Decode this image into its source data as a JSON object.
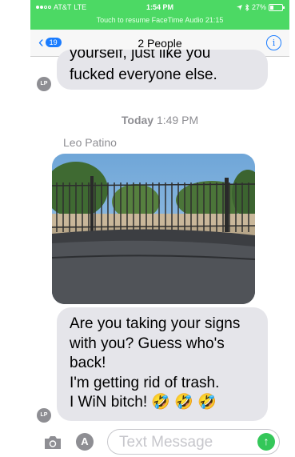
{
  "status_bar": {
    "carrier": "AT&T",
    "network": "LTE",
    "time": "1:54 PM",
    "battery": "27%",
    "battery_level": 0.27,
    "resume_text": "Touch to resume FaceTime Audio 21:15"
  },
  "nav": {
    "back_count": "19",
    "title": "2 People",
    "info_glyph": "i"
  },
  "messages": {
    "previous_text_top": "yourself, just like you",
    "previous_text": "fucked everyone else.",
    "previous_avatar": "LP",
    "timestamp_day": "Today",
    "timestamp_time": "1:49 PM",
    "sender": "Leo Patino",
    "last_lines": [
      "Are you taking your signs",
      "with you? Guess who's",
      "back!",
      "I'm getting rid of trash.",
      "I WiN bitch! 🤣 🤣 🤣"
    ],
    "last_avatar": "LP"
  },
  "input": {
    "placeholder": "Text Message",
    "camera_icon": "camera-icon",
    "apps_icon": "app-store-icon",
    "send_icon": "send-arrow-icon"
  },
  "colors": {
    "status_green": "#4cd964",
    "ios_blue": "#1a7cff",
    "bubble_gray": "#e5e5ea"
  }
}
